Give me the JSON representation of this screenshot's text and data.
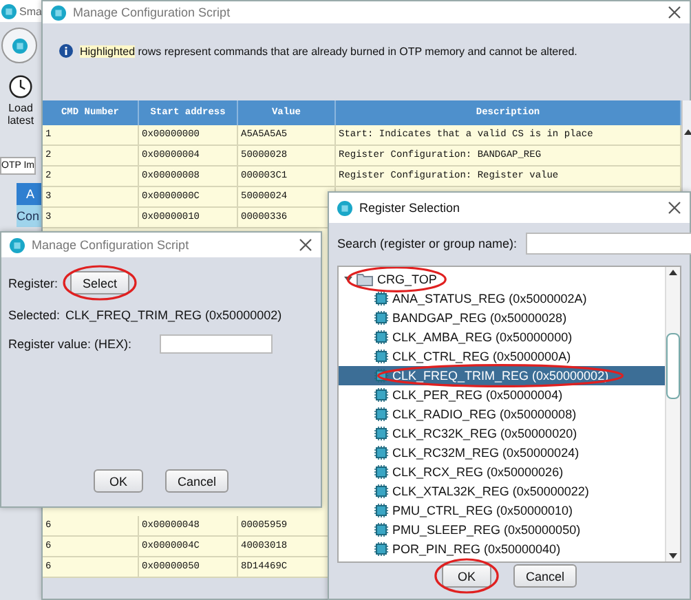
{
  "background_app": {
    "title": "Sma",
    "load_button": "Load latest",
    "tab": "OTP Im",
    "button": "A",
    "item": "Con"
  },
  "main_dialog": {
    "title": "Manage Configuration Script",
    "info": {
      "highlighted": "Highlighted",
      "text": "rows represent commands that are already burned in OTP memory and cannot be altered."
    },
    "table": {
      "columns": [
        "CMD Number",
        "Start address",
        "Value",
        "Description"
      ],
      "rows_top": [
        {
          "cmd": "1",
          "address": "0x00000000",
          "value": "A5A5A5A5",
          "description": "Start: Indicates that a valid CS is in place",
          "highlighted": true
        },
        {
          "cmd": "2",
          "address": "0x00000004",
          "value": "50000028",
          "description": "Register Configuration: BANDGAP_REG",
          "highlighted": true
        },
        {
          "cmd": "2",
          "address": "0x00000008",
          "value": "000003C1",
          "description": "Register Configuration: Register value",
          "highlighted": true
        },
        {
          "cmd": "3",
          "address": "0x0000000C",
          "value": "50000024",
          "highlighted": true
        },
        {
          "cmd": "3",
          "address": "0x00000010",
          "value": "00000336",
          "highlighted": true
        }
      ],
      "rows_bottom": [
        {
          "cmd": "6",
          "address": "0x00000048",
          "value": "00005959",
          "highlighted": true
        },
        {
          "cmd": "6",
          "address": "0x0000004C",
          "value": "40003018",
          "highlighted": true
        },
        {
          "cmd": "6",
          "address": "0x00000050",
          "value": "8D14469C",
          "highlighted": true
        }
      ]
    }
  },
  "edit_dialog": {
    "title": "Manage Configuration Script",
    "register_label": "Register:",
    "select_button": {
      "label": "Select",
      "circled": true
    },
    "selected_label": "Selected:",
    "selected_value": "CLK_FREQ_TRIM_REG (0x50000002)",
    "value_label": "Register value: (HEX):",
    "buttons": [
      {
        "label": "OK",
        "circled": false
      },
      {
        "label": "Cancel",
        "circled": false
      }
    ]
  },
  "register_dialog": {
    "title": "Register Selection",
    "search_label": "Search (register or group name):",
    "tree": {
      "label": "CRG_TOP",
      "expanded": true,
      "circled": true,
      "children": [
        {
          "label": "ANA_STATUS_REG (0x5000002A)",
          "selected": false,
          "circled": false
        },
        {
          "label": "BANDGAP_REG (0x50000028)",
          "selected": false,
          "circled": false
        },
        {
          "label": "CLK_AMBA_REG (0x50000000)",
          "selected": false,
          "circled": false
        },
        {
          "label": "CLK_CTRL_REG (0x5000000A)",
          "selected": false,
          "circled": false
        },
        {
          "label": "CLK_FREQ_TRIM_REG (0x50000002)",
          "selected": true,
          "circled": true
        },
        {
          "label": "CLK_PER_REG (0x50000004)",
          "selected": false,
          "circled": false
        },
        {
          "label": "CLK_RADIO_REG (0x50000008)",
          "selected": false,
          "circled": false
        },
        {
          "label": "CLK_RC32K_REG (0x50000020)",
          "selected": false,
          "circled": false
        },
        {
          "label": "CLK_RC32M_REG (0x50000024)",
          "selected": false,
          "circled": false
        },
        {
          "label": "CLK_RCX_REG (0x50000026)",
          "selected": false,
          "circled": false
        },
        {
          "label": "CLK_XTAL32K_REG (0x50000022)",
          "selected": false,
          "circled": false
        },
        {
          "label": "PMU_CTRL_REG (0x50000010)",
          "selected": false,
          "circled": false
        },
        {
          "label": "PMU_SLEEP_REG (0x50000050)",
          "selected": false,
          "circled": false
        },
        {
          "label": "POR_PIN_REG (0x50000040)",
          "selected": false,
          "circled": false
        }
      ]
    },
    "buttons": [
      {
        "label": "OK",
        "circled": true
      },
      {
        "label": "Cancel",
        "circled": false
      }
    ]
  }
}
